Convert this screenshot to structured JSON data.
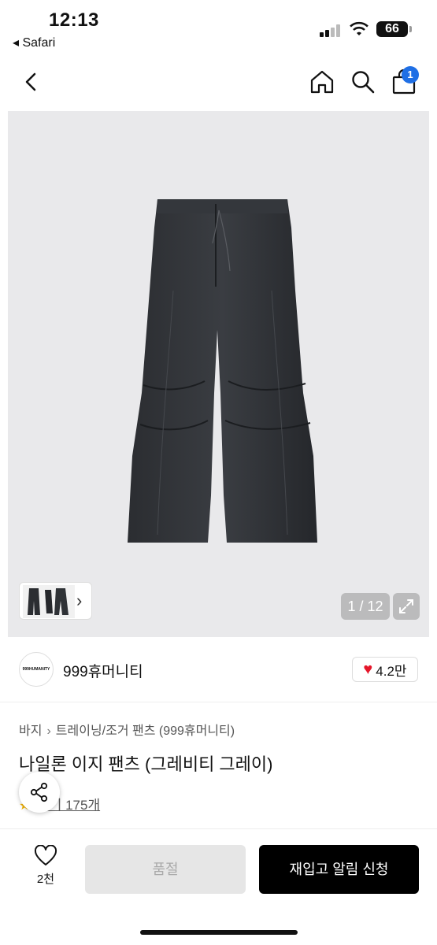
{
  "status_bar": {
    "time": "12:13",
    "back_app": "◂ Safari",
    "battery": "66"
  },
  "nav": {
    "cart_count": "1"
  },
  "gallery": {
    "counter": "1 / 12"
  },
  "brand": {
    "logo_text": "999HUMANITY",
    "name": "999휴머니티",
    "likes": "4.2만"
  },
  "product": {
    "breadcrumb": [
      "바지",
      "트레이닝/조거 팬츠 (999휴머니티)"
    ],
    "title": "나일론 이지 팬츠 (그레비티 그레이)",
    "reviews": "후기 175개"
  },
  "bottom_bar": {
    "wish_count": "2천",
    "soldout_label": "품절",
    "restock_label": "재입고 알림 신청"
  },
  "colors": {
    "accent": "#1f6fe5",
    "heart": "#e5162a",
    "primary_button": "#000000"
  }
}
